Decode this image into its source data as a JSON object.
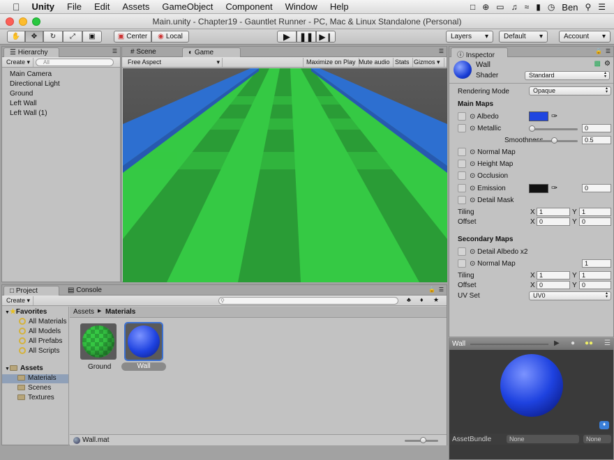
{
  "menubar": {
    "apple": "",
    "app": "Unity",
    "items": [
      "File",
      "Edit",
      "Assets",
      "GameObject",
      "Component",
      "Window",
      "Help"
    ],
    "user": "Ben"
  },
  "window": {
    "title": "Main.unity - Chapter19 - Gauntlet Runner - PC, Mac & Linux Standalone (Personal)"
  },
  "toolbar": {
    "pivot": "Center",
    "space": "Local",
    "layers": "Layers",
    "layout": "Default",
    "account": "Account"
  },
  "hierarchy": {
    "tab": "Hierarchy",
    "create": "Create",
    "search_placeholder": "All",
    "items": [
      "Main Camera",
      "Directional Light",
      "Ground",
      "Left Wall",
      "Left Wall (1)"
    ]
  },
  "center": {
    "tabs": [
      "Scene",
      "Game"
    ],
    "aspect": "Free Aspect",
    "options": [
      "Maximize on Play",
      "Mute audio",
      "Stats",
      "Gizmos"
    ]
  },
  "inspector": {
    "tab": "Inspector",
    "name": "Wall",
    "shader_label": "Shader",
    "shader": "Standard",
    "rendering_mode_label": "Rendering Mode",
    "rendering_mode": "Opaque",
    "main_maps": "Main Maps",
    "albedo": "Albedo",
    "metallic": "Metallic",
    "metallic_value": "0",
    "smoothness": "Smoothness",
    "smoothness_value": "0.5",
    "normal_map": "Normal Map",
    "height_map": "Height Map",
    "occlusion": "Occlusion",
    "emission": "Emission",
    "emission_value": "0",
    "detail_mask": "Detail Mask",
    "tiling": "Tiling",
    "offset": "Offset",
    "x": "X",
    "y": "Y",
    "tiling_x": "1",
    "tiling_y": "1",
    "offset_x": "0",
    "offset_y": "0",
    "secondary_maps": "Secondary Maps",
    "detail_albedo": "Detail Albedo x2",
    "normal_map2": "Normal Map",
    "normal_map2_value": "1",
    "tiling2_x": "1",
    "tiling2_y": "1",
    "offset2_x": "0",
    "offset2_y": "0",
    "uv_set_label": "UV Set",
    "uv_set": "UV0",
    "albedo_color": "#2046e0",
    "emission_color": "#111111"
  },
  "preview": {
    "name": "Wall",
    "assetbundle_label": "AssetBundle",
    "bundle": "None",
    "variant": "None"
  },
  "project": {
    "tabs": [
      "Project",
      "Console"
    ],
    "create": "Create",
    "favorites": "Favorites",
    "fav_items": [
      "All Materials",
      "All Models",
      "All Prefabs",
      "All Scripts"
    ],
    "assets": "Assets",
    "folders": [
      "Materials",
      "Scenes",
      "Textures"
    ],
    "breadcrumb": [
      "Assets",
      "Materials"
    ],
    "files": [
      "Ground",
      "Wall"
    ],
    "selected_file": "Wall.mat"
  }
}
